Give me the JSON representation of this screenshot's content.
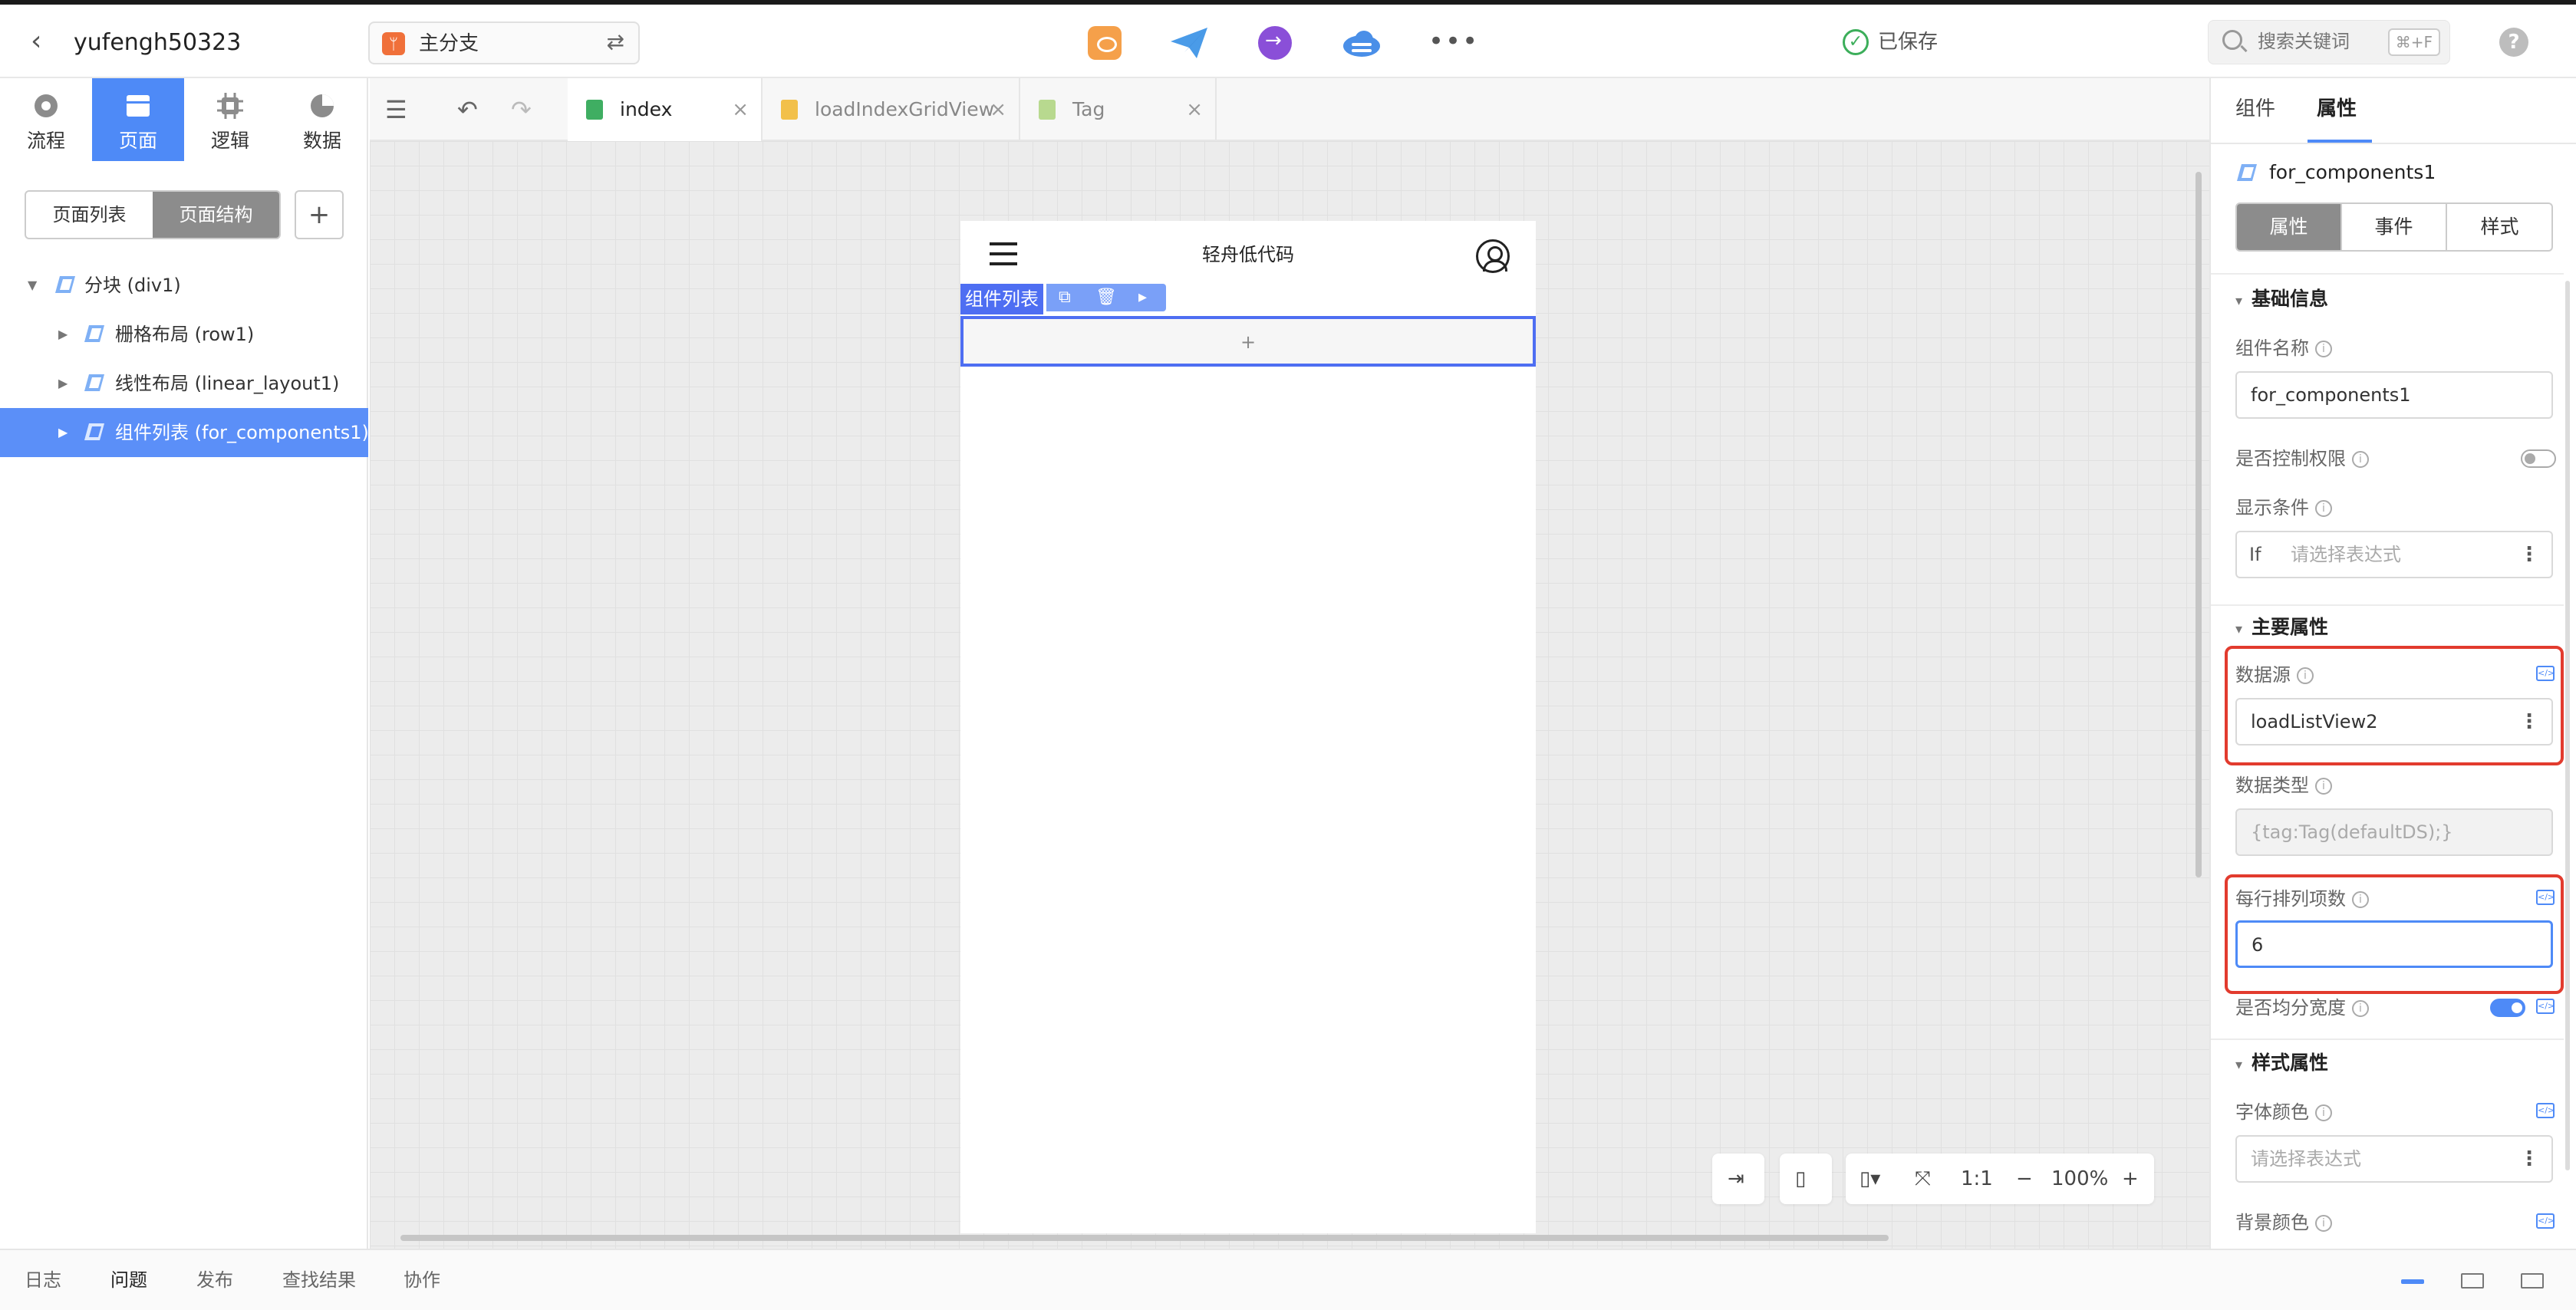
{
  "app": {
    "project_name": "yufengh50323",
    "branch": "主分支"
  },
  "status": {
    "saved": "已保存"
  },
  "search": {
    "placeholder": "搜索关键词",
    "shortcut": "⌘+F"
  },
  "left_modes": [
    {
      "label": "流程",
      "icon": "flow-icon"
    },
    {
      "label": "页面",
      "icon": "page-icon",
      "active": true
    },
    {
      "label": "逻辑",
      "icon": "logic-icon"
    },
    {
      "label": "数据",
      "icon": "data-icon"
    }
  ],
  "page_tabs": {
    "list": "页面列表",
    "structure": "页面结构",
    "add": "+"
  },
  "tree": [
    {
      "label": "分块 (div1)",
      "level": 0,
      "expanded": true
    },
    {
      "label": "栅格布局 (row1)",
      "level": 1
    },
    {
      "label": "线性布局 (linear_layout1)",
      "level": 1
    },
    {
      "label": "组件列表 (for_components1)",
      "level": 1,
      "selected": true
    }
  ],
  "editor_tabs": [
    {
      "label": "index",
      "icon": "page-file-icon",
      "active": true
    },
    {
      "label": "loadIndexGridView",
      "icon": "logic-file-icon"
    },
    {
      "label": "Tag",
      "icon": "entity-file-icon"
    }
  ],
  "phone": {
    "title": "轻舟低代码",
    "component_tag": "组件列表",
    "placeholder_plus": "+"
  },
  "zoom": {
    "ratio_label": "1:1",
    "level": "100%"
  },
  "right_panel": {
    "tabs": [
      "组件",
      "属性"
    ],
    "active_tab": "属性",
    "component_name": "for_components1",
    "sub_tabs": [
      "属性",
      "事件",
      "样式"
    ],
    "sections": {
      "basic": "基础信息",
      "main": "主要属性",
      "style": "样式属性"
    },
    "fields": {
      "name_label": "组件名称",
      "name_value": "for_components1",
      "permission_label": "是否控制权限",
      "permission_on": false,
      "condition_label": "显示条件",
      "condition_prefix": "If",
      "condition_placeholder": "请选择表达式",
      "datasource_label": "数据源",
      "datasource_value": "loadListView2",
      "datatype_label": "数据类型",
      "datatype_value": "{tag:Tag(defaultDS);}",
      "per_row_label": "每行排列项数",
      "per_row_value": "6",
      "equal_width_label": "是否均分宽度",
      "equal_width_on": true,
      "font_color_label": "字体颜色",
      "font_color_placeholder": "请选择表达式",
      "bg_color_label": "背景颜色"
    }
  },
  "bottom_tabs": [
    {
      "label": "日志"
    },
    {
      "label": "问题",
      "active": true
    },
    {
      "label": "发布"
    },
    {
      "label": "查找结果"
    },
    {
      "label": "协作"
    }
  ],
  "colors": {
    "accent": "#4e8af7",
    "selection": "#4e6ef2",
    "highlight": "#e23b2e",
    "saved": "#3cae5a"
  }
}
